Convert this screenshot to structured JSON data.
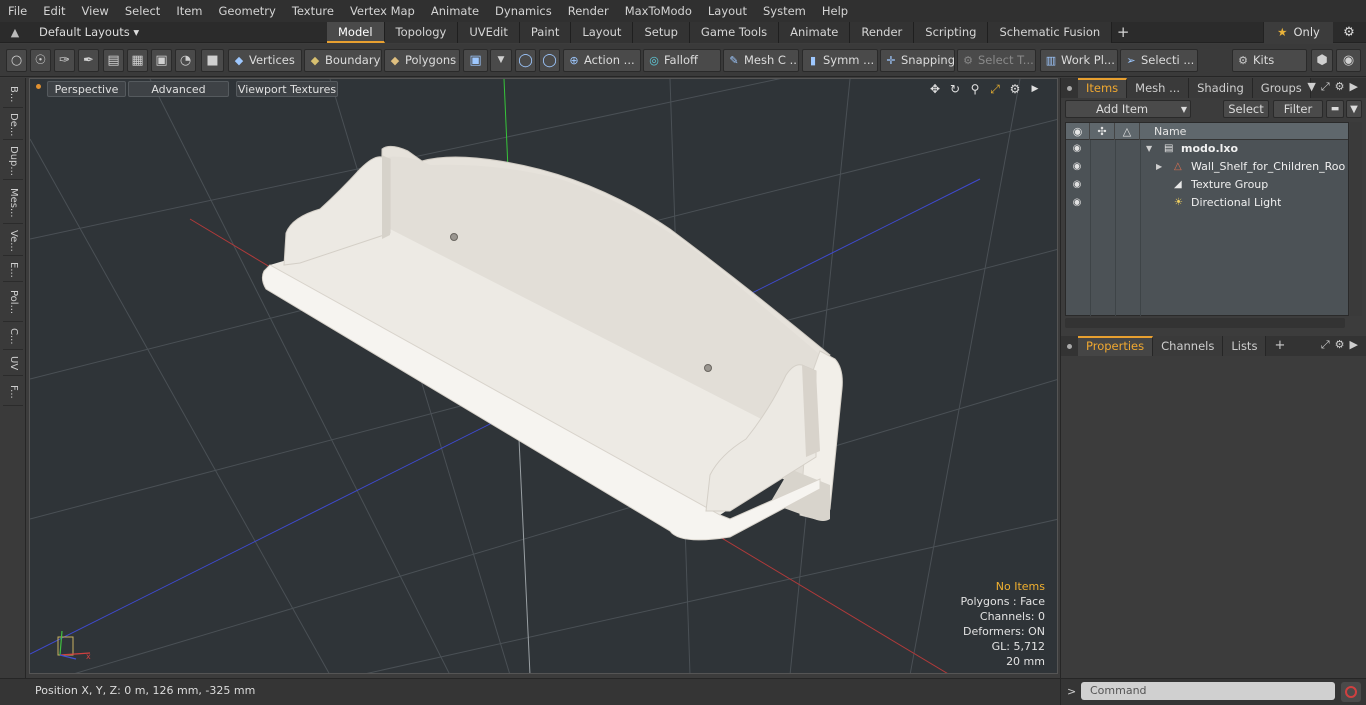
{
  "menu": [
    "File",
    "Edit",
    "View",
    "Select",
    "Item",
    "Geometry",
    "Texture",
    "Vertex Map",
    "Animate",
    "Dynamics",
    "Render",
    "MaxToModo",
    "Layout",
    "System",
    "Help"
  ],
  "layouts_label": "Default Layouts ▾",
  "tabs": [
    "Model",
    "Topology",
    "UVEdit",
    "Paint",
    "Layout",
    "Setup",
    "Game Tools",
    "Animate",
    "Render",
    "Scripting",
    "Schematic Fusion"
  ],
  "active_tab": "Model",
  "only_label": "Only",
  "toolbar": {
    "vertices": "Vertices",
    "boundary": "Boundary",
    "polygons": "Polygons",
    "action": "Action ...",
    "falloff": "Falloff",
    "mesh": "Mesh C ...",
    "symm": "Symm ...",
    "snapping": "Snapping",
    "select_t": "Select T...",
    "work_pl": "Work Pl...",
    "selecti": "Selecti ...",
    "kits": "Kits"
  },
  "left_tools": [
    "B...",
    "De...",
    "Dup...",
    "Mes...",
    "Ve...",
    "E...",
    "Pol...",
    "C...",
    "UV",
    "F..."
  ],
  "viewport": {
    "perspective": "Perspective",
    "advanced": "Advanced",
    "textures": "Viewport Textures",
    "info": {
      "no_items": "No Items",
      "polygons": "Polygons : Face",
      "channels": "Channels: 0",
      "deformers": "Deformers: ON",
      "gl": "GL: 5,712",
      "scale": "20 mm"
    }
  },
  "status": {
    "position": "Position X, Y, Z:   0 m, 126 mm, -325 mm"
  },
  "items_panel": {
    "tabs": [
      "Items",
      "Mesh ...",
      "Shading",
      "Groups"
    ],
    "active": "Items",
    "add_item": "Add Item",
    "select": "Select",
    "filter": "Filter",
    "name_header": "Name",
    "rows": [
      {
        "label": "modo.lxo"
      },
      {
        "label": "Wall_Shelf_for_Children_Roo ..."
      },
      {
        "label": "Texture Group"
      },
      {
        "label": "Directional Light"
      }
    ]
  },
  "props_panel": {
    "tabs": [
      "Properties",
      "Channels",
      "Lists"
    ],
    "active": "Properties"
  },
  "command": {
    "placeholder": "Command"
  },
  "colors": {
    "accent": "#e8a030",
    "viewport_bg": "#2f3438",
    "shelf": "#eeeae4",
    "axis_x": "#d04040",
    "axis_y": "#40d040",
    "axis_z": "#4050d0"
  }
}
